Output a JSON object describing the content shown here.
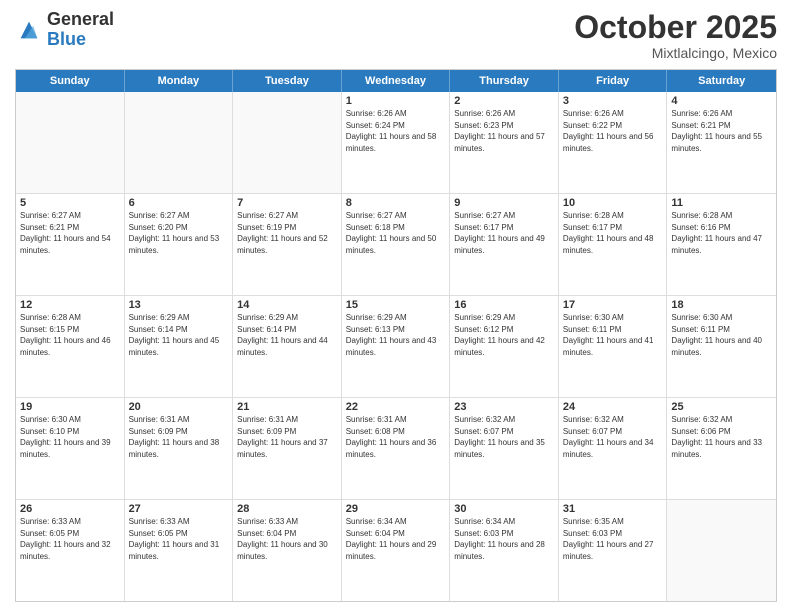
{
  "logo": {
    "general": "General",
    "blue": "Blue"
  },
  "title": "October 2025",
  "location": "Mixtlalcingo, Mexico",
  "days_of_week": [
    "Sunday",
    "Monday",
    "Tuesday",
    "Wednesday",
    "Thursday",
    "Friday",
    "Saturday"
  ],
  "weeks": [
    [
      {
        "day": "",
        "info": ""
      },
      {
        "day": "",
        "info": ""
      },
      {
        "day": "",
        "info": ""
      },
      {
        "day": "1",
        "info": "Sunrise: 6:26 AM\nSunset: 6:24 PM\nDaylight: 11 hours and 58 minutes."
      },
      {
        "day": "2",
        "info": "Sunrise: 6:26 AM\nSunset: 6:23 PM\nDaylight: 11 hours and 57 minutes."
      },
      {
        "day": "3",
        "info": "Sunrise: 6:26 AM\nSunset: 6:22 PM\nDaylight: 11 hours and 56 minutes."
      },
      {
        "day": "4",
        "info": "Sunrise: 6:26 AM\nSunset: 6:21 PM\nDaylight: 11 hours and 55 minutes."
      }
    ],
    [
      {
        "day": "5",
        "info": "Sunrise: 6:27 AM\nSunset: 6:21 PM\nDaylight: 11 hours and 54 minutes."
      },
      {
        "day": "6",
        "info": "Sunrise: 6:27 AM\nSunset: 6:20 PM\nDaylight: 11 hours and 53 minutes."
      },
      {
        "day": "7",
        "info": "Sunrise: 6:27 AM\nSunset: 6:19 PM\nDaylight: 11 hours and 52 minutes."
      },
      {
        "day": "8",
        "info": "Sunrise: 6:27 AM\nSunset: 6:18 PM\nDaylight: 11 hours and 50 minutes."
      },
      {
        "day": "9",
        "info": "Sunrise: 6:27 AM\nSunset: 6:17 PM\nDaylight: 11 hours and 49 minutes."
      },
      {
        "day": "10",
        "info": "Sunrise: 6:28 AM\nSunset: 6:17 PM\nDaylight: 11 hours and 48 minutes."
      },
      {
        "day": "11",
        "info": "Sunrise: 6:28 AM\nSunset: 6:16 PM\nDaylight: 11 hours and 47 minutes."
      }
    ],
    [
      {
        "day": "12",
        "info": "Sunrise: 6:28 AM\nSunset: 6:15 PM\nDaylight: 11 hours and 46 minutes."
      },
      {
        "day": "13",
        "info": "Sunrise: 6:29 AM\nSunset: 6:14 PM\nDaylight: 11 hours and 45 minutes."
      },
      {
        "day": "14",
        "info": "Sunrise: 6:29 AM\nSunset: 6:14 PM\nDaylight: 11 hours and 44 minutes."
      },
      {
        "day": "15",
        "info": "Sunrise: 6:29 AM\nSunset: 6:13 PM\nDaylight: 11 hours and 43 minutes."
      },
      {
        "day": "16",
        "info": "Sunrise: 6:29 AM\nSunset: 6:12 PM\nDaylight: 11 hours and 42 minutes."
      },
      {
        "day": "17",
        "info": "Sunrise: 6:30 AM\nSunset: 6:11 PM\nDaylight: 11 hours and 41 minutes."
      },
      {
        "day": "18",
        "info": "Sunrise: 6:30 AM\nSunset: 6:11 PM\nDaylight: 11 hours and 40 minutes."
      }
    ],
    [
      {
        "day": "19",
        "info": "Sunrise: 6:30 AM\nSunset: 6:10 PM\nDaylight: 11 hours and 39 minutes."
      },
      {
        "day": "20",
        "info": "Sunrise: 6:31 AM\nSunset: 6:09 PM\nDaylight: 11 hours and 38 minutes."
      },
      {
        "day": "21",
        "info": "Sunrise: 6:31 AM\nSunset: 6:09 PM\nDaylight: 11 hours and 37 minutes."
      },
      {
        "day": "22",
        "info": "Sunrise: 6:31 AM\nSunset: 6:08 PM\nDaylight: 11 hours and 36 minutes."
      },
      {
        "day": "23",
        "info": "Sunrise: 6:32 AM\nSunset: 6:07 PM\nDaylight: 11 hours and 35 minutes."
      },
      {
        "day": "24",
        "info": "Sunrise: 6:32 AM\nSunset: 6:07 PM\nDaylight: 11 hours and 34 minutes."
      },
      {
        "day": "25",
        "info": "Sunrise: 6:32 AM\nSunset: 6:06 PM\nDaylight: 11 hours and 33 minutes."
      }
    ],
    [
      {
        "day": "26",
        "info": "Sunrise: 6:33 AM\nSunset: 6:05 PM\nDaylight: 11 hours and 32 minutes."
      },
      {
        "day": "27",
        "info": "Sunrise: 6:33 AM\nSunset: 6:05 PM\nDaylight: 11 hours and 31 minutes."
      },
      {
        "day": "28",
        "info": "Sunrise: 6:33 AM\nSunset: 6:04 PM\nDaylight: 11 hours and 30 minutes."
      },
      {
        "day": "29",
        "info": "Sunrise: 6:34 AM\nSunset: 6:04 PM\nDaylight: 11 hours and 29 minutes."
      },
      {
        "day": "30",
        "info": "Sunrise: 6:34 AM\nSunset: 6:03 PM\nDaylight: 11 hours and 28 minutes."
      },
      {
        "day": "31",
        "info": "Sunrise: 6:35 AM\nSunset: 6:03 PM\nDaylight: 11 hours and 27 minutes."
      },
      {
        "day": "",
        "info": ""
      }
    ]
  ]
}
